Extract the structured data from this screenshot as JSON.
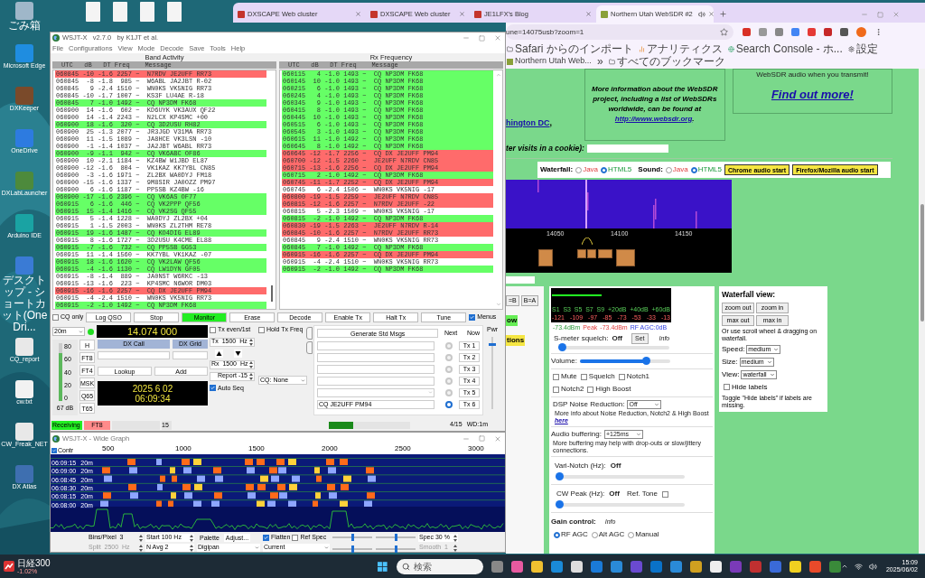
{
  "desktop": {
    "icons": [
      {
        "label": "ごみ箱",
        "kind": "japanese"
      },
      {
        "label": "Microsoft Edge",
        "kind": "latin"
      },
      {
        "label": "DXKeeper",
        "kind": "latin"
      },
      {
        "label": "OneDrive",
        "kind": "latin"
      },
      {
        "label": "DXLabLauncher",
        "kind": "latin"
      },
      {
        "label": "Arduino IDE",
        "kind": "latin"
      },
      {
        "label": "デスクトップ - ショートカット(OneDri...",
        "kind": "japanese"
      },
      {
        "label": "CQ_report",
        "kind": "latin"
      },
      {
        "label": "cw.txt",
        "kind": "latin"
      },
      {
        "label": "CW_Freak_NET",
        "kind": "latin"
      },
      {
        "label": "DX Atlas",
        "kind": "latin"
      }
    ],
    "widget": {
      "name": "日経300",
      "change": "-1.02%"
    }
  },
  "browser": {
    "tabs": [
      {
        "title": "DXSCAPE Web cluster",
        "selected": false
      },
      {
        "title": "DXSCAPE Web cluster",
        "selected": false
      },
      {
        "title": "JE1LFX's Blog",
        "selected": false
      },
      {
        "title": "Northern Utah WebSDR #2",
        "selected": true
      }
    ],
    "url": "une=14075usb?zoom=1",
    "bookmarks": [
      {
        "label": "Safari からのインポート",
        "kind": "folder"
      },
      {
        "label": "アナリティクス",
        "kind": "chart"
      },
      {
        "label": "Search Console - ホ...",
        "kind": "site"
      },
      {
        "label": "設定",
        "kind": "gear"
      },
      {
        "label": "Northern Utah Web...",
        "kind": "page"
      },
      {
        "label": "»",
        "kind": "more"
      },
      {
        "label": "すべてのブックマーク",
        "kind": "folder"
      }
    ],
    "page": {
      "location": {
        "link": "hington DC",
        "after": ","
      },
      "info_box": {
        "text": "More information about the WebSDR project, including a list of WebSDRs worldwide, can be found at",
        "link": "http://www.websdr.org",
        "after": "."
      },
      "promo": {
        "text": "WebSDR audio when you transmit!",
        "link": "Find out more!"
      },
      "cookie_label": "ter visits in a cookie):",
      "stream_bar": {
        "waterfall_label": "Waterfall:",
        "waterfall_options": [
          {
            "label": "Java",
            "selected": false
          },
          {
            "label": "HTML5",
            "selected": true
          }
        ],
        "sound_label": "Sound:",
        "sound_options": [
          {
            "label": "Java",
            "selected": false
          },
          {
            "label": "HTML5",
            "selected": true
          }
        ],
        "buttons": [
          "Chrome audio start",
          "Firefox/Mozilla audio start"
        ]
      },
      "waterfall": {
        "scale": [
          "14050",
          "14100",
          "14150"
        ]
      },
      "left_strip": {
        "buttons": [
          "=B",
          "B=A"
        ],
        "labels": [
          {
            "text": "ow",
            "color": "#66ee55"
          },
          {
            "text": "tions",
            "color": "#f5e642"
          }
        ]
      },
      "smeter": {
        "level": 0.41,
        "scale": [
          "S1",
          "S3",
          "S5",
          "S7",
          "S9",
          "+20dB",
          "+40dB",
          "+60dB"
        ],
        "dbm": [
          "-121",
          "-109",
          "-97",
          "-85",
          "-73",
          "-53",
          "-33",
          "-13"
        ],
        "reading": "-73.4dBm",
        "peak_label": "Peak",
        "peak": "-73.4dBm",
        "agc": "RF AGC:0dB"
      },
      "squelch": {
        "label": "S-meter squelch:",
        "value": "Off",
        "button": "Set",
        "info": "Info",
        "level": 0
      },
      "volume": {
        "label": "Volume:",
        "level": 0.76
      },
      "toggles": [
        {
          "label": "Mute",
          "checked": false
        },
        {
          "label": "Squelch",
          "checked": false
        },
        {
          "label": "Notch1",
          "checked": false
        },
        {
          "label": "Notch2",
          "checked": false
        },
        {
          "label": "High Boost",
          "checked": false
        }
      ],
      "dsp": {
        "label": "DSP Noise Reduction:",
        "value": "Off",
        "note": "More info about Noise Reduction, Notch2 & High Boost",
        "link": "here"
      },
      "buffering": {
        "label": "Audio buffering:",
        "value": "+125ms",
        "note": "More buffering may help with drop-outs or slow/jittery connections."
      },
      "vari_notch": {
        "label": "Vari-Notch (Hz):",
        "value": "Off",
        "level": 0
      },
      "cw_peak": {
        "label": "CW Peak (Hz):",
        "value": "Off",
        "ref_label": "Ref. Tone",
        "ref_checked": false,
        "level": 0
      },
      "gain": {
        "label": "Gain control:",
        "info": "Info",
        "options": [
          {
            "label": "RF AGC",
            "selected": true
          },
          {
            "label": "Alt AGC",
            "selected": false
          },
          {
            "label": "Manual",
            "selected": false
          }
        ]
      },
      "waterfall_view": {
        "title": "Waterfall view:",
        "buttons": [
          "zoom out",
          "zoom in",
          "max out",
          "max in"
        ],
        "note": "Or use scroll wheel & dragging on waterfall.",
        "selects": [
          {
            "label": "Speed:",
            "value": "medium"
          },
          {
            "label": "Size:",
            "value": "medium"
          },
          {
            "label": "View:",
            "value": "waterfall"
          }
        ],
        "hide_labels": {
          "label": "Hide labels",
          "checked": false
        },
        "hint": "Toggle \"Hide labels\" if labels are missing."
      }
    }
  },
  "wsjtx": {
    "title": "WSJT-X   v2.7.0   by K1JT et al.",
    "menu": [
      "File",
      "Configurations",
      "View",
      "Mode",
      "Decode",
      "Save",
      "Tools",
      "Help"
    ],
    "band_activity": {
      "title": "Band Activity",
      "header": "UTC   dB   DT Freq    Message",
      "rows": [
        {
          "line": "060845 -10 -1.6 2257 ~  N7RDV JE2UFF RR73",
          "color": "#ff6b6b"
        },
        {
          "line": "060845  -8 -1.8  985 ~  W6ABL JA2JBT R-02",
          "color": "#ffffff"
        },
        {
          "line": "060845   9 -2.4 1510 ~  WN0KS VK5NIG RR73",
          "color": "#ffffff"
        },
        {
          "line": "060845 -10 -1.7 1007 ~  KS3F LU4AE R-18",
          "color": "#ffffff"
        },
        {
          "line": "060845   7 -1.0 1492 ~  CQ NP3DM FK68",
          "color": "#66ff66"
        },
        {
          "line": "060900  14 -1.6  602 ~  KD6UYK VK3AUX QF22",
          "color": "#ffffff"
        },
        {
          "line": "060900  14 -1.4 2243 ~  N2LCX KP4SMC +00",
          "color": "#ffffff"
        },
        {
          "line": "060900  18 -1.6  320 ~  CQ 3D2USU RH82",
          "color": "#66ff66"
        },
        {
          "line": "060900  25 -1.3 2077 ~  JR3JGD V31MA RR73",
          "color": "#ffffff"
        },
        {
          "line": "060900  11 -1.5 1089 ~  JA8HCE VK3LSN -10",
          "color": "#ffffff"
        },
        {
          "line": "060900  -1 -1.4 1037 ~  JA2JBT W6ABL RR73",
          "color": "#ffffff"
        },
        {
          "line": "060900  -9 -1.1  942 ~  CQ VK6ABC OF86",
          "color": "#66ff66"
        },
        {
          "line": "060900  10 -2.1 1184 ~  KZ4BW W1JBD EL87",
          "color": "#ffffff"
        },
        {
          "line": "060900 -12 -1.6  804 ~  VK1KAZ KK7YBL CN85",
          "color": "#ffffff"
        },
        {
          "line": "060900  -3 -1.6 1971 ~  ZL2BX WA0DYJ FM18",
          "color": "#ffffff"
        },
        {
          "line": "060900 -15 -1.6 1337 ~  9M8SIR JA0OZZ PM97",
          "color": "#ffffff"
        },
        {
          "line": "060900   6 -1.6 1187 ~  PP5SB KZ4BW -16",
          "color": "#ffffff"
        },
        {
          "line": "060900 -17 -1.6 2396 ~  CQ VK6AS OF77",
          "color": "#66ff66"
        },
        {
          "line": "060915   6 -1.6  446 ~  CQ VK2PPP QF56",
          "color": "#66ff66"
        },
        {
          "line": "060915  15 -1.4 1416 ~  CQ VK2SG QF55",
          "color": "#66ff66"
        },
        {
          "line": "060915   5 -1.4 1228 ~  WA0DYJ ZL2BX +04",
          "color": "#ffffff"
        },
        {
          "line": "060915   1 -1.5 2003 ~  WN0KS ZL2THM RE78",
          "color": "#ffffff"
        },
        {
          "line": "060915  19 -1.6 1487 ~  CQ KO4DIG EL89",
          "color": "#66ff66"
        },
        {
          "line": "060915   8 -1.6 1727 ~  3D2USU K4CME EL88",
          "color": "#ffffff"
        },
        {
          "line": "060915  -7 -1.6  732 ~  CQ PP5SB GG53",
          "color": "#66ff66"
        },
        {
          "line": "060915  11 -1.4 1560 ~  KK7YBL VK1KAZ -07",
          "color": "#ffffff"
        },
        {
          "line": "060915  18 -1.6 1620 ~  CQ VK2LAW QF56",
          "color": "#66ff66"
        },
        {
          "line": "060915  -4 -1.6 1130 ~  CQ LW1DYN GF05",
          "color": "#66ff66"
        },
        {
          "line": "060915  -8 -1.4  889 ~  JA0NST W6RKC -13",
          "color": "#ffffff"
        },
        {
          "line": "060915 -13 -1.6  223 ~  KP4SMC N6WOR DM03",
          "color": "#ffffff"
        },
        {
          "line": "060915 -16 -1.6 2257 ~  CQ DX JE2UFF PM94",
          "color": "#ff6b6b"
        },
        {
          "line": "060915  -4 -2.4 1510 ~  WN0KS VK5NIG RR73",
          "color": "#ffffff"
        },
        {
          "line": "060915  -2 -1.0 1492 ~  CQ NP3DM FK68",
          "color": "#66ff66"
        }
      ]
    },
    "rx_frequency": {
      "title": "Rx Frequency",
      "header": "UTC   dB   DT Freq    Message",
      "rows": [
        {
          "line": "060115   4 -1.0 1493 ~  CQ NP3DM FK68",
          "color": "#66ff66"
        },
        {
          "line": "060145  10 -1.0 1493 ~  CQ NP3DM FK68",
          "color": "#66ff66"
        },
        {
          "line": "060215   6 -1.0 1493 ~  CQ NP3DM FK68",
          "color": "#66ff66"
        },
        {
          "line": "060245   4 -1.0 1493 ~  CQ NP3DM FK68",
          "color": "#66ff66"
        },
        {
          "line": "060345   9 -1.0 1493 ~  CQ NP3DM FK68",
          "color": "#66ff66"
        },
        {
          "line": "060415   8 -1.0 1493 ~  CQ NP3DM FK68",
          "color": "#66ff66"
        },
        {
          "line": "060445  10 -1.0 1493 ~  CQ NP3DM FK68",
          "color": "#66ff66"
        },
        {
          "line": "060515   6 -1.0 1493 ~  CQ NP3DM FK68",
          "color": "#66ff66"
        },
        {
          "line": "060545   3 -1.0 1493 ~  CQ NP3DM FK68",
          "color": "#66ff66"
        },
        {
          "line": "060615  11 -1.0 1492 ~  CQ NP3DM FK68",
          "color": "#66ff66"
        },
        {
          "line": "060645   8 -1.0 1492 ~  CQ NP3DM FK68",
          "color": "#66ff66"
        },
        {
          "line": "060645 -12 -1.7 2256 ~  CQ DX JE2UFF PM94",
          "color": "#ff6b6b"
        },
        {
          "line": "060700 -12 -1.5 2260 ~  JE2UFF N7RDV CN85",
          "color": "#ff6b6b"
        },
        {
          "line": "060715 -13 -1.6 2256 ~  CQ DX JE2UFF PM94",
          "color": "#ff6b6b"
        },
        {
          "line": "060715   2 -1.0 1492 ~  CQ NP3DM FK68",
          "color": "#66ff66"
        },
        {
          "line": "060745 -11 -1.7 2252 ~  CQ DX JE2UFF PM94",
          "color": "#ff6b6b"
        },
        {
          "line": "060745   6 -2.4 1506 ~  WN0KS VK5NIG -17",
          "color": "#ffffff"
        },
        {
          "line": "060800 -19 -1.5 2259 ~  JE2UFF N7RDV CN85",
          "color": "#ff6b6b"
        },
        {
          "line": "060815 -12 -1.6 2257 ~  N7RDV JE2UFF -22",
          "color": "#ff6b6b"
        },
        {
          "line": "060815   5 -2.3 1509 ~  WN0KS VK5NIG -17",
          "color": "#ffffff"
        },
        {
          "line": "060815  -2 -1.0 1492 ~  CQ NP3DM FK68",
          "color": "#66ff66"
        },
        {
          "line": "060830 -19 -1.5 2263 ~  JE2UFF N7RDV R-14",
          "color": "#ff6b6b"
        },
        {
          "line": "060845 -10 -1.6 2257 ~  N7RDV JE2UFF RR73",
          "color": "#ff6b6b"
        },
        {
          "line": "060845   9 -2.4 1510 ~  WN0KS VK5NIG RR73",
          "color": "#ffffff"
        },
        {
          "line": "060845   7 -1.0 1492 ~  CQ NP3DM FK68",
          "color": "#66ff66"
        },
        {
          "line": "060915 -16 -1.6 2257 ~  CQ DX JE2UFF PM94",
          "color": "#ff6b6b"
        },
        {
          "line": "060915  -4 -2.4 1510 ~  WN0KS VK5NIG RR73",
          "color": "#ffffff"
        },
        {
          "line": "060915  -2 -1.0 1492 ~  CQ NP3DM FK68",
          "color": "#66ff66"
        }
      ]
    },
    "cq_only": {
      "label": "CQ only",
      "checked": false
    },
    "buttons": [
      {
        "label": "Log QSO",
        "selected": false
      },
      {
        "label": "Stop",
        "selected": false
      },
      {
        "label": "Monitor",
        "selected": true
      },
      {
        "label": "Erase",
        "selected": false
      },
      {
        "label": "Decode",
        "selected": false
      },
      {
        "label": "Enable Tx",
        "selected": false
      },
      {
        "label": "Halt Tx",
        "selected": false
      },
      {
        "label": "Tune",
        "selected": false
      }
    ],
    "menus": {
      "label": "Menus",
      "checked": true
    },
    "band": "20m",
    "frequency": "14.074 000",
    "meter": {
      "ticks": [
        "80",
        "60",
        "40",
        "20",
        "0"
      ],
      "level": 0.83,
      "reading": "67 dB"
    },
    "modes": [
      "H",
      "FT8",
      "FT4",
      "MSK",
      "Q65",
      "T65"
    ],
    "dx_call": "DX Call",
    "dx_grid": "DX Grid",
    "lookup": "Lookup",
    "add": "Add",
    "date": "2025 6 02",
    "time": "06:09:34",
    "tx_even": {
      "label": "Tx even/1st",
      "checked": false
    },
    "hold_tx": {
      "label": "Hold Tx Freq",
      "checked": false
    },
    "tx_freq": "Tx  1500  Hz",
    "rx_freq": "Rx  1500  Hz",
    "report": "Report -15",
    "auto_seq": {
      "label": "Auto Seq",
      "checked": true
    },
    "cq_select": "CQ: None",
    "generate": "Generate Std Msgs",
    "next_label": "Next",
    "now_label": "Now",
    "messages": [
      {
        "kind": "field",
        "selected": false,
        "button": "Tx 1"
      },
      {
        "kind": "field",
        "selected": false,
        "button": "Tx 2"
      },
      {
        "kind": "field",
        "selected": false,
        "button": "Tx 3"
      },
      {
        "kind": "field",
        "selected": false,
        "button": "Tx 4"
      },
      {
        "kind": "dropdown",
        "selected": false,
        "button": "Tx 5"
      },
      {
        "kind": "field",
        "value": "CQ JE2UFF PM94",
        "selected": true,
        "button": "Tx 6"
      }
    ],
    "pwr_label": "Pwr",
    "pwr": {
      "level": 0.9
    },
    "status": {
      "state": "Receiving",
      "mode": "FT8",
      "period": "15",
      "level": 0.3,
      "count": "4/15",
      "wd": "WD:1m"
    }
  },
  "wide_graph": {
    "title": "WSJT-X - Wide Graph",
    "contr": {
      "label": "Contr",
      "checked": true
    },
    "ticks": [
      "500",
      "1000",
      "1500",
      "2000",
      "2500",
      "3000"
    ],
    "rows": [
      {
        "time": "06:09:15",
        "band": "20m"
      },
      {
        "time": "06:09:00",
        "band": "20m"
      },
      {
        "time": "06:08:45",
        "band": "20m"
      },
      {
        "time": "06:08:30",
        "band": "20m"
      },
      {
        "time": "06:08:15",
        "band": "20m"
      },
      {
        "time": "06:08:00",
        "band": "20m"
      }
    ],
    "controls": {
      "bins": "Bins/Pixel  3",
      "start": "Start 100 Hz",
      "palette": "Palette",
      "adjust": "Adjust...",
      "flatten": {
        "label": "Flatten",
        "checked": true
      },
      "ref_spec": {
        "label": "Ref Spec",
        "checked": false
      },
      "spec": "Spec 30 %",
      "split": {
        "text": "Split  2500  Hz",
        "disabled": true
      },
      "navg": "N Avg 2",
      "palette_value": "Digipan",
      "mode_value": "Current",
      "smooth": {
        "text": "Smooth  1",
        "disabled": true
      },
      "sliders": [
        {
          "level": 0.5
        },
        {
          "level": 0.5
        },
        {
          "level": 0.5
        },
        {
          "level": 0.5
        }
      ]
    }
  },
  "taskbar": {
    "search": "検索",
    "time": "15:09",
    "date": "2025/06/02"
  }
}
